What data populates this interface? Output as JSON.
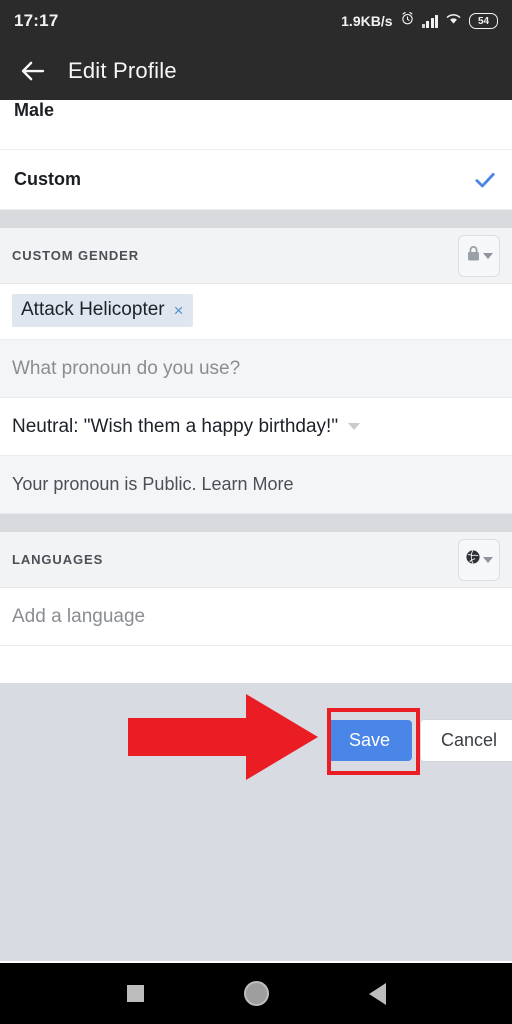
{
  "status_bar": {
    "time": "17:17",
    "network_speed": "1.9KB/s",
    "alarm_icon": "alarm-clock-icon",
    "signal_icon": "cellular-signal-icon",
    "wifi_icon": "wifi-icon",
    "battery_level": "54"
  },
  "app_bar": {
    "back_icon": "back-arrow-icon",
    "title": "Edit Profile"
  },
  "gender_options": [
    {
      "label": "Male",
      "selected": false
    },
    {
      "label": "Custom",
      "selected": true
    }
  ],
  "custom_gender": {
    "section_title": "CUSTOM GENDER",
    "privacy_icon": "lock-icon",
    "privacy_caret": "chevron-down-icon",
    "chip_label": "Attack Helicopter",
    "chip_remove": "×",
    "pronoun_placeholder": "What pronoun do you use?",
    "pronoun_value": "Neutral: \"Wish them a happy birthday!\"",
    "pronoun_caret": "chevron-down-icon",
    "privacy_note": "Your pronoun is Public. Learn More"
  },
  "languages": {
    "section_title": "LANGUAGES",
    "privacy_icon": "globe-icon",
    "privacy_caret": "chevron-down-icon",
    "add_placeholder": "Add a language"
  },
  "footer": {
    "save_label": "Save",
    "cancel_label": "Cancel"
  },
  "annotations": {
    "arrow_icon": "red-right-arrow-annotation",
    "highlight_target": "save-button",
    "accent_red": "#ea1d25"
  },
  "nav_bar": {
    "recents_icon": "recents-square-icon",
    "home_icon": "home-circle-icon",
    "back_icon": "back-triangle-icon"
  },
  "colors": {
    "accent_blue": "#4a86e8",
    "chip_bg": "#dfe6ef",
    "section_bg": "#f2f3f5",
    "footer_bg": "#d8dce2",
    "bar_bg": "#2b2b2b"
  }
}
